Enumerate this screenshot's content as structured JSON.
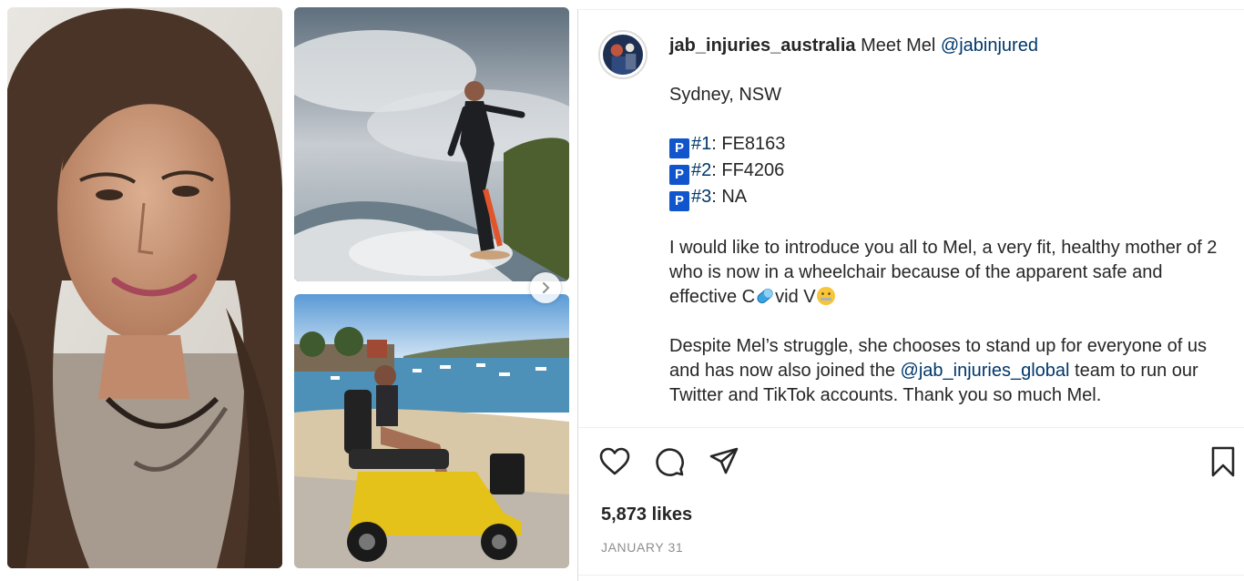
{
  "post": {
    "username": "jab_injuries_australia",
    "caption_intro": "Meet Mel",
    "caption_mention": "@jabinjured",
    "location_line": "Sydney, NSW",
    "doses": [
      {
        "badge": "P",
        "tag": "#1",
        "value": ": FE8163"
      },
      {
        "badge": "P",
        "tag": "#2",
        "value": ": FF4206"
      },
      {
        "badge": "P",
        "tag": "#3",
        "value": ": NA"
      }
    ],
    "paragraph1_a": "I would like to introduce you all to Mel, a very fit, healthy mother of 2 who is now in a wheelchair because of the apparent safe and effective C",
    "paragraph1_b": "vid V",
    "paragraph2_a": "Despite Mel’s struggle, she chooses to stand up for everyone of us and has now also joined the ",
    "paragraph2_mention": "@jab_injuries_global",
    "paragraph2_b": " team to run our Twitter and TikTok accounts. Thank you so much Mel.",
    "likes": "5,873 likes",
    "date": "JANUARY 31"
  },
  "icons": {
    "like": "heart-icon",
    "comment": "comment-icon",
    "share": "paper-plane-icon",
    "save": "bookmark-icon",
    "next": "chevron-right-icon"
  },
  "colors": {
    "link": "#00376b",
    "text": "#262626",
    "muted": "#8e8e8e",
    "badge": "#1155cc"
  }
}
